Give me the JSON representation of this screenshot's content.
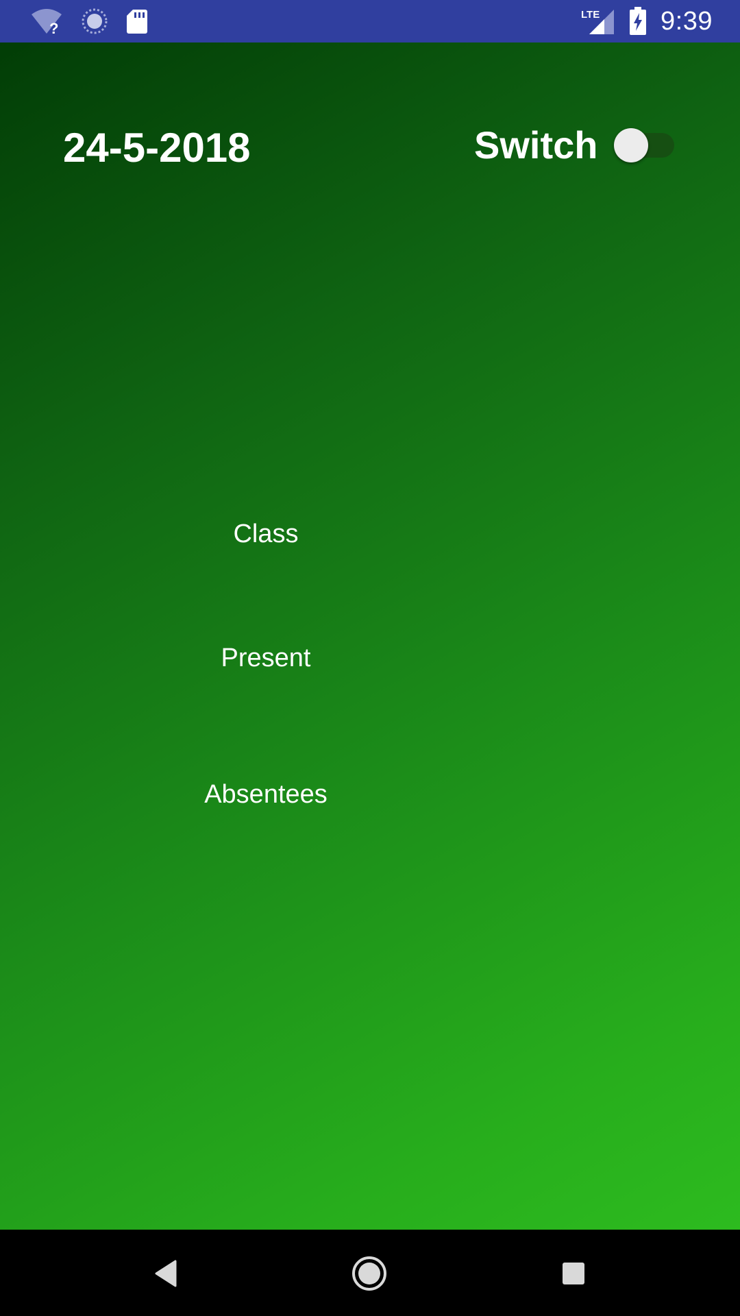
{
  "status_bar": {
    "time": "9:39",
    "network_label": "LTE",
    "left_icons": [
      "wifi-unknown-icon",
      "sync-spinner-icon",
      "sd-card-icon"
    ],
    "right_icons": [
      "lte-signal-icon",
      "battery-charging-icon"
    ],
    "background_color": "#303f9f"
  },
  "main": {
    "date": "24-5-2018",
    "switch": {
      "label": "Switch",
      "state": "off"
    },
    "items": {
      "class_label": "Class",
      "present_label": "Present",
      "absentees_label": "Absentees"
    },
    "gradient_colors": [
      "#023d06",
      "#2dbb1f"
    ]
  },
  "nav_bar": {
    "buttons": [
      "back-icon",
      "home-icon",
      "recents-icon"
    ]
  }
}
